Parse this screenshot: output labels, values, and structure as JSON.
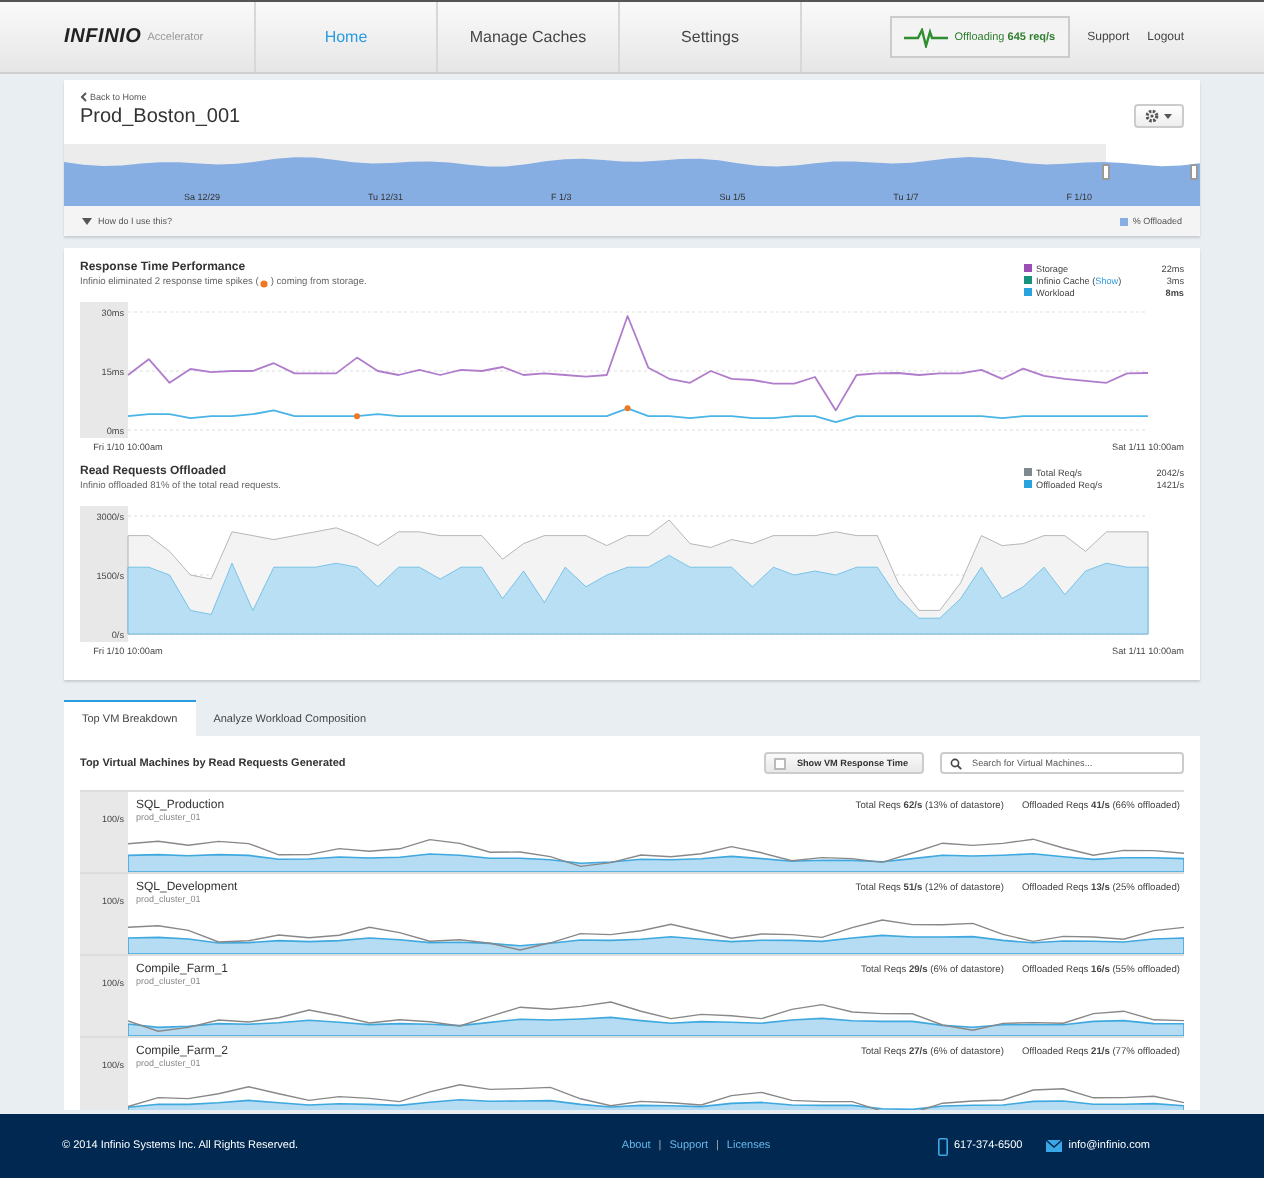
{
  "header": {
    "logo": "INFINIO",
    "product": "Accelerator",
    "nav": [
      {
        "label": "Home",
        "selected": true
      },
      {
        "label": "Manage Caches",
        "selected": false
      },
      {
        "label": "Settings",
        "selected": false
      }
    ],
    "status": "Offloading **645 req/s**",
    "links": [
      "Support",
      "Logout"
    ]
  },
  "page": {
    "back": "Back to Home",
    "title": "Prod_Boston_001",
    "timeline": {
      "labels": [
        "Sa 12/29",
        "Tu 12/31",
        "F 1/3",
        "Su 1/5",
        "Tu 1/7",
        "F 1/10"
      ],
      "help": "How do I use this?",
      "legend": "% Offloaded"
    }
  },
  "response": {
    "title": "Response Time Performance",
    "note_before": "Infinio eliminated 2 response time spikes (",
    "note_after": ") coming from storage.",
    "legend": [
      {
        "name": "Storage",
        "value": "22ms",
        "color": "#9b4fb5",
        "bold": false
      },
      {
        "name": "Infinio Cache (",
        "link": "Show",
        "name_end": ")",
        "value": "3ms",
        "color": "#17907e",
        "bold": false
      },
      {
        "name": "Workload",
        "value": "8ms",
        "color": "#2aa3dc",
        "bold": true
      }
    ],
    "chart_data": {
      "type": "line",
      "ylim": [
        0,
        30
      ],
      "yticks": [
        {
          "value": 0,
          "label": "0ms"
        },
        {
          "value": 15,
          "label": "15ms"
        },
        {
          "value": 30,
          "label": "30ms"
        }
      ],
      "categories": [
        "Fri 1/10 10:00am",
        null,
        null,
        null,
        null,
        null,
        null,
        null,
        null,
        null,
        null,
        null,
        null,
        null,
        null,
        null,
        null,
        null,
        null,
        null,
        null,
        null,
        null,
        null,
        null,
        null,
        null,
        null,
        null,
        null,
        null,
        null,
        null,
        null,
        null,
        null,
        null,
        null,
        null,
        null,
        null,
        null,
        null,
        null,
        null,
        null,
        null,
        null,
        null,
        "Sat 1/11 10:00am"
      ],
      "series": [
        {
          "color": "#b07ccc",
          "values": [
            14,
            18,
            12,
            15.5,
            14.7,
            15,
            15,
            17,
            14.4,
            14.4,
            14.4,
            18.4,
            15,
            14,
            15.3,
            14,
            15.3,
            15,
            16,
            14,
            14.4,
            14,
            13.6,
            14,
            29,
            15.8,
            13,
            12,
            15,
            13,
            12.7,
            11.8,
            11.8,
            13.5,
            5,
            14,
            14.4,
            14.5,
            14,
            14.4,
            14.4,
            15.3,
            13,
            15.6,
            13.8,
            13,
            12.5,
            12,
            14.4,
            14.5
          ]
        },
        {
          "color": "#4bb4e6",
          "values": [
            3.5,
            4,
            4,
            3,
            3.5,
            3.5,
            4,
            5,
            3.5,
            3.5,
            3.5,
            3.5,
            4,
            3.5,
            3.5,
            3.5,
            3.5,
            3.5,
            3.5,
            3.5,
            3.5,
            3.5,
            3.5,
            3.5,
            5.5,
            3.5,
            3.5,
            3,
            3.5,
            3.5,
            3,
            3,
            3.5,
            3.5,
            2,
            3.5,
            3.5,
            3.5,
            3.5,
            3.5,
            3.5,
            3.5,
            3,
            3.5,
            3.5,
            3.5,
            3.5,
            3.5,
            3.5,
            3.5
          ]
        }
      ]
    }
  },
  "offload": {
    "title": "Read Requests Offloaded",
    "note": "Infinio offloaded 81% of the total read requests.",
    "legend": [
      {
        "name": "Total Req/s",
        "value": "2042/s",
        "color": "#7d8a8f"
      },
      {
        "name": "Offloaded Req/s",
        "value": "1421/s",
        "color": "#2aa3dc"
      }
    ],
    "chart_data": {
      "type": "area",
      "ylim": [
        0,
        3000
      ],
      "yticks": [
        {
          "value": 0,
          "label": "0/s"
        },
        {
          "value": 1500,
          "label": "1500/s"
        },
        {
          "value": 3000,
          "label": "3000/s"
        }
      ],
      "categories": [
        "Fri 1/10 10:00am",
        null,
        null,
        null,
        null,
        null,
        null,
        null,
        null,
        null,
        null,
        null,
        null,
        null,
        null,
        null,
        null,
        null,
        null,
        null,
        null,
        null,
        null,
        null,
        null,
        null,
        null,
        null,
        null,
        null,
        null,
        null,
        null,
        null,
        null,
        null,
        null,
        null,
        null,
        null,
        null,
        null,
        null,
        null,
        null,
        null,
        null,
        null,
        null,
        "Sat 1/11 10:00am"
      ],
      "series": [
        {
          "color": "#8a8a8a",
          "values": [
            2500,
            2500,
            2100,
            1500,
            1400,
            2600,
            2500,
            2400,
            2500,
            2600,
            2700,
            2500,
            2250,
            2600,
            2600,
            2500,
            2500,
            2500,
            1900,
            2300,
            2500,
            2500,
            2500,
            2250,
            2500,
            2500,
            2900,
            2300,
            2200,
            2400,
            2300,
            2500,
            2500,
            2500,
            2600,
            2500,
            2500,
            1300,
            600,
            600,
            1300,
            2500,
            2250,
            2300,
            2500,
            2500,
            2100,
            2600,
            2600,
            2600
          ]
        },
        {
          "color": "#3ea8df",
          "values": [
            1700,
            1700,
            1500,
            600,
            500,
            1800,
            600,
            1700,
            1700,
            1700,
            1800,
            1700,
            1200,
            1700,
            1700,
            1400,
            1700,
            1700,
            900,
            1600,
            800,
            1700,
            1200,
            1500,
            1700,
            1700,
            2000,
            1700,
            1700,
            1700,
            1200,
            1700,
            1500,
            1600,
            1500,
            1700,
            1700,
            900,
            400,
            400,
            900,
            1700,
            900,
            1200,
            1700,
            1000,
            1600,
            1800,
            1700,
            1700
          ]
        }
      ]
    }
  },
  "tabs": [
    {
      "label": "Top VM Breakdown",
      "selected": true
    },
    {
      "label": "Analyze Workload Composition",
      "selected": false
    }
  ],
  "vms": {
    "title": "Top Virtual Machines by Read Requests Generated",
    "toggle": {
      "label": "Show VM Response Time",
      "checked": false
    },
    "search": {
      "placeholder": "Search for Virtual Machines..."
    },
    "rows": [
      {
        "tick": "100/s",
        "name": "SQL_Production",
        "cluster": "prod_cluster_01",
        "total": "Total Reqs **62/s** (13% of datastore)",
        "offloaded": "Offloaded Reqs **41/s** (66% offloaded)"
      },
      {
        "tick": "100/s",
        "name": "SQL_Development",
        "cluster": "prod_cluster_01",
        "total": "Total Reqs **51/s** (12% of datastore)",
        "offloaded": "Offloaded Reqs **13/s** (25% offloaded)"
      },
      {
        "tick": "100/s",
        "name": "Compile_Farm_1",
        "cluster": "prod_cluster_01",
        "total": "Total Reqs **29/s** (6% of datastore)",
        "offloaded": "Offloaded Reqs **16/s** (55% offloaded)"
      },
      {
        "tick": "100/s",
        "name": "Compile_Farm_2",
        "cluster": "prod_cluster_01",
        "total": "Total Reqs **27/s** (6% of datastore)",
        "offloaded": "Offloaded Reqs **21/s** (77% offloaded)"
      }
    ]
  },
  "footer": {
    "copyright": "© 2014 Infinio Systems Inc.  All Rights Reserved.",
    "links": [
      "About",
      "Support",
      "Licenses"
    ],
    "separator": "|",
    "phone": "617-374-6500",
    "email": "info@infinio.com"
  }
}
